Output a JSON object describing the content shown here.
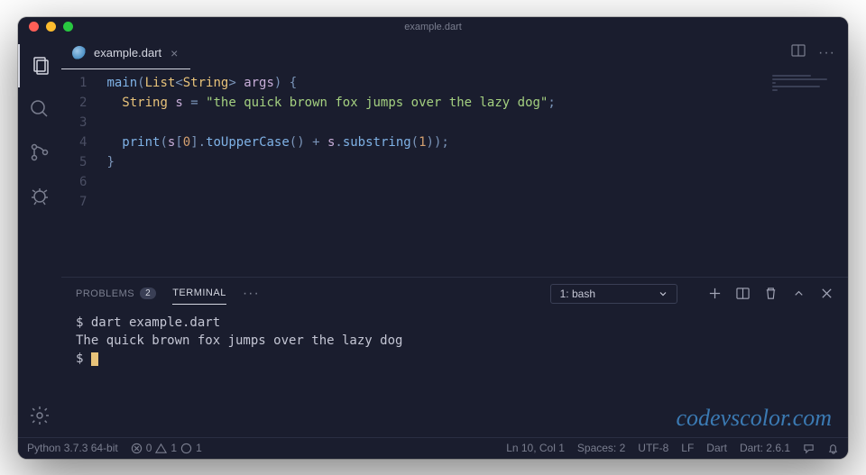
{
  "window": {
    "title": "example.dart"
  },
  "tab": {
    "filename": "example.dart"
  },
  "code": {
    "lines": [
      {
        "n": 1
      },
      {
        "n": 2
      },
      {
        "n": 3
      },
      {
        "n": 4
      },
      {
        "n": 5
      },
      {
        "n": 6
      },
      {
        "n": 7
      }
    ],
    "tokens": {
      "main": "main",
      "list": "List",
      "string": "String",
      "args": "args",
      "s": "s",
      "str_literal": "\"the quick brown fox jumps over the lazy dog\"",
      "print": "print",
      "zero": "0",
      "toUpperCase": "toUpperCase",
      "substring": "substring",
      "one": "1"
    }
  },
  "panel": {
    "tabs": {
      "problems": "PROBLEMS",
      "problems_count": "2",
      "terminal": "TERMINAL"
    },
    "terminal_select": "1: bash",
    "output": {
      "cmd_prompt": "$ ",
      "cmd": "dart example.dart",
      "result": "The quick brown fox jumps over the lazy dog",
      "prompt2": "$ "
    }
  },
  "statusbar": {
    "python": "Python 3.7.3 64-bit",
    "errors": "0",
    "warnings": "1",
    "info": "1",
    "position": "Ln 10, Col 1",
    "spaces": "Spaces: 2",
    "encoding": "UTF-8",
    "eol": "LF",
    "lang": "Dart",
    "dart_version": "Dart: 2.6.1"
  },
  "watermark": "codevscolor.com"
}
